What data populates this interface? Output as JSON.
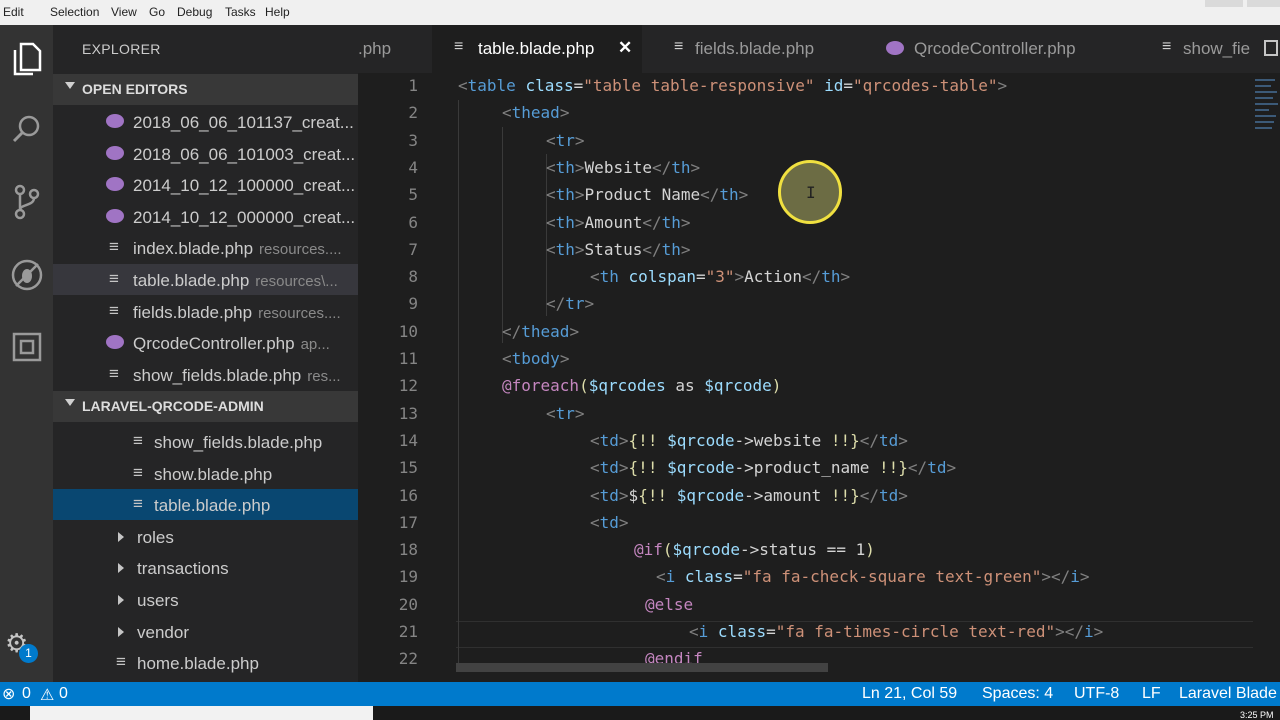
{
  "menu": [
    "Edit",
    "Selection",
    "View",
    "Go",
    "Debug",
    "Tasks",
    "Help"
  ],
  "activity_icons": [
    "explorer-icon",
    "search-icon",
    "source-control-icon",
    "debug-icon",
    "extensions-icon"
  ],
  "settings_badge": "1",
  "explorer": {
    "title": "EXPLORER",
    "open_editors_label": "OPEN EDITORS",
    "open_editors": [
      {
        "name": "2018_06_06_101137_creat...",
        "path": "",
        "type": "php"
      },
      {
        "name": "2018_06_06_101003_creat...",
        "path": "",
        "type": "php"
      },
      {
        "name": "2014_10_12_100000_creat...",
        "path": "",
        "type": "php"
      },
      {
        "name": "2014_10_12_000000_creat...",
        "path": "",
        "type": "php"
      },
      {
        "name": "index.blade.php",
        "path": "resources....",
        "type": "blade"
      },
      {
        "name": "table.blade.php",
        "path": "resources\\...",
        "type": "blade"
      },
      {
        "name": "fields.blade.php",
        "path": "resources....",
        "type": "blade"
      },
      {
        "name": "QrcodeController.php",
        "path": "ap...",
        "type": "php"
      },
      {
        "name": "show_fields.blade.php",
        "path": "res...",
        "type": "blade"
      }
    ],
    "project_label": "LARAVEL-QRCODE-ADMIN",
    "tree": [
      {
        "name": "show_fields.blade.php",
        "kind": "file"
      },
      {
        "name": "show.blade.php",
        "kind": "file"
      },
      {
        "name": "table.blade.php",
        "kind": "file"
      },
      {
        "name": "roles",
        "kind": "folder"
      },
      {
        "name": "transactions",
        "kind": "folder"
      },
      {
        "name": "users",
        "kind": "folder"
      },
      {
        "name": "vendor",
        "kind": "folder"
      },
      {
        "name": "home.blade.php",
        "kind": "file"
      }
    ]
  },
  "tabs": [
    {
      "name": ".php",
      "active": false,
      "icon": "php"
    },
    {
      "name": "table.blade.php",
      "active": true,
      "icon": "blade"
    },
    {
      "name": "fields.blade.php",
      "active": false,
      "icon": "blade"
    },
    {
      "name": "QrcodeController.php",
      "active": false,
      "icon": "php"
    },
    {
      "name": "show_fie",
      "active": false,
      "icon": "blade"
    }
  ],
  "close_glyph": "✕",
  "code_lines": [
    {
      "n": "1",
      "indent": 0,
      "tokens": [
        [
          "brk",
          "<"
        ],
        [
          "tag",
          "table"
        ],
        [
          "txt",
          " "
        ],
        [
          "attr",
          "class"
        ],
        [
          "txt",
          "="
        ],
        [
          "str",
          "\"table table-responsive\""
        ],
        [
          "txt",
          " "
        ],
        [
          "attr",
          "id"
        ],
        [
          "txt",
          "="
        ],
        [
          "str",
          "\"qrcodes-table\""
        ],
        [
          "brk",
          ">"
        ]
      ]
    },
    {
      "n": "2",
      "indent": 1,
      "tokens": [
        [
          "brk",
          "<"
        ],
        [
          "tag",
          "thead"
        ],
        [
          "brk",
          ">"
        ]
      ]
    },
    {
      "n": "3",
      "indent": 2,
      "tokens": [
        [
          "brk",
          "<"
        ],
        [
          "tag",
          "tr"
        ],
        [
          "brk",
          ">"
        ]
      ]
    },
    {
      "n": "4",
      "indent": 2,
      "tokens": [
        [
          "brk",
          "<"
        ],
        [
          "tag",
          "th"
        ],
        [
          "brk",
          ">"
        ],
        [
          "txt",
          "Website"
        ],
        [
          "brk",
          "</"
        ],
        [
          "tag",
          "th"
        ],
        [
          "brk",
          ">"
        ]
      ]
    },
    {
      "n": "5",
      "indent": 2,
      "tokens": [
        [
          "brk",
          "<"
        ],
        [
          "tag",
          "th"
        ],
        [
          "brk",
          ">"
        ],
        [
          "txt",
          "Product Name"
        ],
        [
          "brk",
          "</"
        ],
        [
          "tag",
          "th"
        ],
        [
          "brk",
          ">"
        ]
      ]
    },
    {
      "n": "6",
      "indent": 2,
      "tokens": [
        [
          "brk",
          "<"
        ],
        [
          "tag",
          "th"
        ],
        [
          "brk",
          ">"
        ],
        [
          "txt",
          "Amount"
        ],
        [
          "brk",
          "</"
        ],
        [
          "tag",
          "th"
        ],
        [
          "brk",
          ">"
        ]
      ]
    },
    {
      "n": "7",
      "indent": 2,
      "tokens": [
        [
          "brk",
          "<"
        ],
        [
          "tag",
          "th"
        ],
        [
          "brk",
          ">"
        ],
        [
          "txt",
          "Status"
        ],
        [
          "brk",
          "</"
        ],
        [
          "tag",
          "th"
        ],
        [
          "brk",
          ">"
        ]
      ]
    },
    {
      "n": "8",
      "indent": 3,
      "tokens": [
        [
          "brk",
          "<"
        ],
        [
          "tag",
          "th"
        ],
        [
          "txt",
          " "
        ],
        [
          "attr",
          "colspan"
        ],
        [
          "txt",
          "="
        ],
        [
          "str",
          "\"3\""
        ],
        [
          "brk",
          ">"
        ],
        [
          "txt",
          "Action"
        ],
        [
          "brk",
          "</"
        ],
        [
          "tag",
          "th"
        ],
        [
          "brk",
          ">"
        ]
      ]
    },
    {
      "n": "9",
      "indent": 2,
      "tokens": [
        [
          "brk",
          "</"
        ],
        [
          "tag",
          "tr"
        ],
        [
          "brk",
          ">"
        ]
      ]
    },
    {
      "n": "10",
      "indent": 1,
      "tokens": [
        [
          "brk",
          "</"
        ],
        [
          "tag",
          "thead"
        ],
        [
          "brk",
          ">"
        ]
      ]
    },
    {
      "n": "11",
      "indent": 1,
      "tokens": [
        [
          "brk",
          "<"
        ],
        [
          "tag",
          "tbody"
        ],
        [
          "brk",
          ">"
        ]
      ]
    },
    {
      "n": "12",
      "indent": 1,
      "tokens": [
        [
          "kw",
          "@foreach"
        ],
        [
          "blade",
          "("
        ],
        [
          "attr",
          "$qrcodes"
        ],
        [
          "txt",
          " as "
        ],
        [
          "attr",
          "$qrcode"
        ],
        [
          "blade",
          ")"
        ]
      ]
    },
    {
      "n": "13",
      "indent": 2,
      "tokens": [
        [
          "brk",
          "<"
        ],
        [
          "tag",
          "tr"
        ],
        [
          "brk",
          ">"
        ]
      ]
    },
    {
      "n": "14",
      "indent": 3,
      "tokens": [
        [
          "brk",
          "<"
        ],
        [
          "tag",
          "td"
        ],
        [
          "brk",
          ">"
        ],
        [
          "blade",
          "{!! "
        ],
        [
          "attr",
          "$qrcode"
        ],
        [
          "txt",
          "->website "
        ],
        [
          "blade",
          "!!}"
        ],
        [
          "brk",
          "</"
        ],
        [
          "tag",
          "td"
        ],
        [
          "brk",
          ">"
        ]
      ]
    },
    {
      "n": "15",
      "indent": 3,
      "tokens": [
        [
          "brk",
          "<"
        ],
        [
          "tag",
          "td"
        ],
        [
          "brk",
          ">"
        ],
        [
          "blade",
          "{!! "
        ],
        [
          "attr",
          "$qrcode"
        ],
        [
          "txt",
          "->product_name "
        ],
        [
          "blade",
          "!!}"
        ],
        [
          "brk",
          "</"
        ],
        [
          "tag",
          "td"
        ],
        [
          "brk",
          ">"
        ]
      ]
    },
    {
      "n": "16",
      "indent": 3,
      "tokens": [
        [
          "brk",
          "<"
        ],
        [
          "tag",
          "td"
        ],
        [
          "brk",
          ">"
        ],
        [
          "txt",
          "$"
        ],
        [
          "blade",
          "{!! "
        ],
        [
          "attr",
          "$qrcode"
        ],
        [
          "txt",
          "->amount "
        ],
        [
          "blade",
          "!!}"
        ],
        [
          "brk",
          "</"
        ],
        [
          "tag",
          "td"
        ],
        [
          "brk",
          ">"
        ]
      ]
    },
    {
      "n": "17",
      "indent": 3,
      "tokens": [
        [
          "brk",
          "<"
        ],
        [
          "tag",
          "td"
        ],
        [
          "brk",
          ">"
        ]
      ]
    },
    {
      "n": "18",
      "indent": 4,
      "tokens": [
        [
          "kw",
          "@if"
        ],
        [
          "blade",
          "("
        ],
        [
          "attr",
          "$qrcode"
        ],
        [
          "txt",
          "->status == 1"
        ],
        [
          "blade",
          ")"
        ]
      ]
    },
    {
      "n": "19",
      "indent": 4.5,
      "tokens": [
        [
          "brk",
          "<"
        ],
        [
          "tag",
          "i"
        ],
        [
          "txt",
          " "
        ],
        [
          "attr",
          "class"
        ],
        [
          "txt",
          "="
        ],
        [
          "str",
          "\"fa fa-check-square text-green\""
        ],
        [
          "brk",
          "></"
        ],
        [
          "tag",
          "i"
        ],
        [
          "brk",
          ">"
        ]
      ]
    },
    {
      "n": "20",
      "indent": 4.25,
      "tokens": [
        [
          "kw",
          "@else"
        ]
      ]
    },
    {
      "n": "21",
      "indent": 5.25,
      "tokens": [
        [
          "brk",
          "<"
        ],
        [
          "tag",
          "i"
        ],
        [
          "txt",
          " "
        ],
        [
          "attr",
          "class"
        ],
        [
          "txt",
          "="
        ],
        [
          "str",
          "\"fa fa-times-circle text-red\""
        ],
        [
          "brk",
          "></"
        ],
        [
          "tag",
          "i"
        ],
        [
          "brk",
          ">"
        ]
      ]
    },
    {
      "n": "22",
      "indent": 4.25,
      "tokens": [
        [
          "kw",
          "@endif"
        ]
      ]
    }
  ],
  "status": {
    "errors": "0",
    "warnings": "0",
    "position": "Ln 21, Col 59",
    "spaces": "Spaces: 4",
    "encoding": "UTF-8",
    "eol": "LF",
    "language": "Laravel Blade"
  },
  "taskbar_time": "3:25 PM"
}
